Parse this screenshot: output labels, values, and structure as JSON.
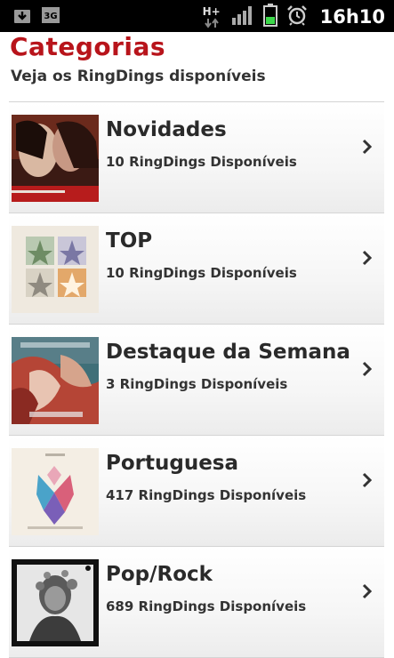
{
  "status_bar": {
    "network": "H+",
    "clock": "16h10",
    "icons": [
      "download-icon",
      "3g-icon",
      "network-h-plus-icon",
      "signal-icon",
      "battery-icon",
      "alarm-icon"
    ]
  },
  "header": {
    "title": "Categorias",
    "subtitle": "Veja os RingDings disponíveis"
  },
  "categories": [
    {
      "title": "Novidades",
      "subtitle": "10 RingDings Disponíveis"
    },
    {
      "title": "TOP",
      "subtitle": "10 RingDings Disponíveis"
    },
    {
      "title": "Destaque da Semana",
      "subtitle": "3 RingDings Disponíveis"
    },
    {
      "title": "Portuguesa",
      "subtitle": "417 RingDings Disponíveis"
    },
    {
      "title": "Pop/Rock",
      "subtitle": "689 RingDings Disponíveis"
    }
  ],
  "colors": {
    "title": "#b8141b",
    "text": "#2a2a2a",
    "divider": "#d4d4d4"
  }
}
